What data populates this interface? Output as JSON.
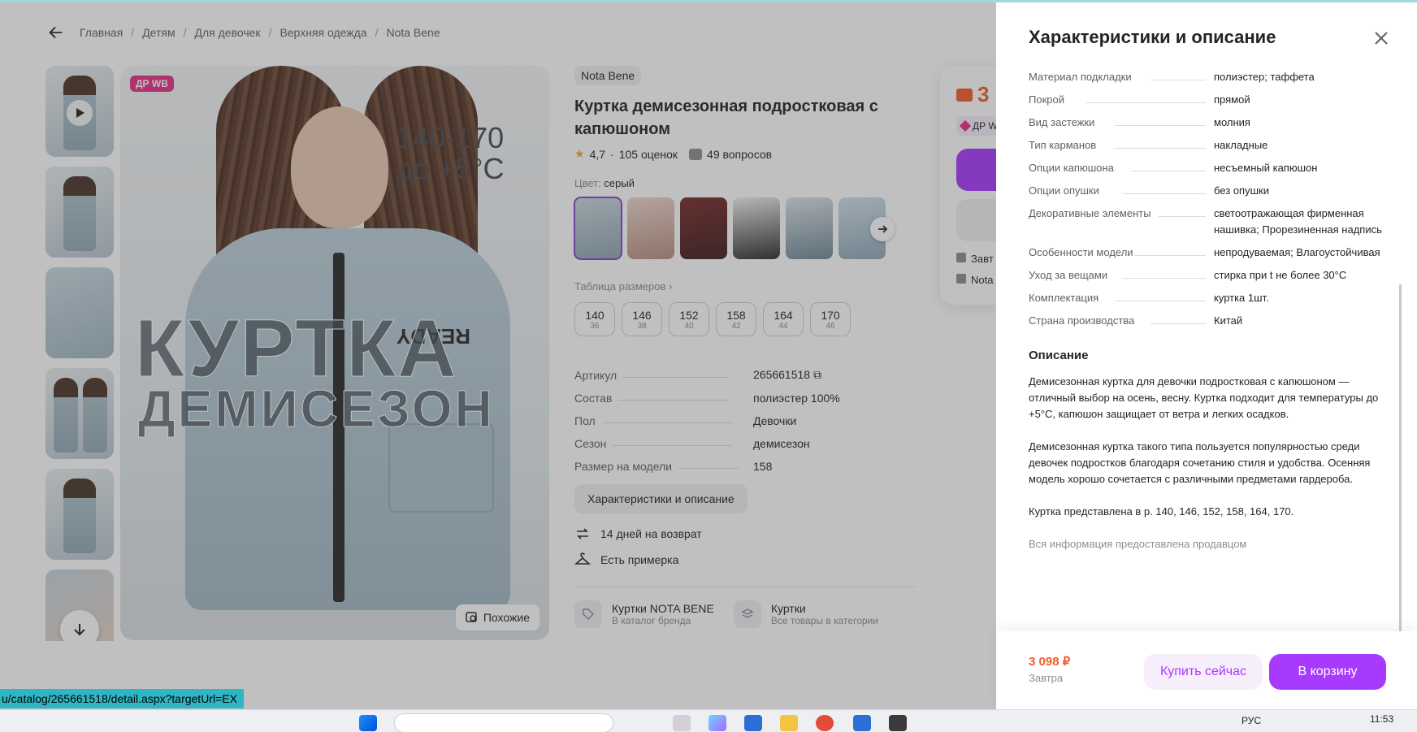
{
  "breadcrumbs": [
    "Главная",
    "Детям",
    "Для девочек",
    "Верхняя одежда",
    "Nota Bene"
  ],
  "product": {
    "badge": "ДР WB",
    "image_size_text": "140-170",
    "image_temp_text": "до +5°С",
    "image_title": "КУРТКА",
    "image_subtitle": "ДЕМИСЕЗОН",
    "image_print": "READY",
    "similar_label": "Похожие",
    "brand": "Nota Bene",
    "title": "Куртка демисезонная подростковая с капюшоном",
    "rating": "4,7",
    "reviews": "105 оценок",
    "questions": "49 вопросов",
    "color_label": "Цвет:",
    "color_value": "серый",
    "size_table_label": "Таблица размеров",
    "sizes": [
      {
        "a": "140",
        "b": "36"
      },
      {
        "a": "146",
        "b": "38"
      },
      {
        "a": "152",
        "b": "40"
      },
      {
        "a": "158",
        "b": "42"
      },
      {
        "a": "164",
        "b": "44"
      },
      {
        "a": "170",
        "b": "46"
      }
    ],
    "specs": [
      {
        "k": "Артикул",
        "v": "265661518"
      },
      {
        "k": "Состав",
        "v": "полиэстер 100%"
      },
      {
        "k": "Пол",
        "v": "Девочки"
      },
      {
        "k": "Сезон",
        "v": "демисезон"
      },
      {
        "k": "Размер на модели",
        "v": "158"
      }
    ],
    "char_button": "Характеристики и описание",
    "return_label": "14 дней на возврат",
    "fitting_label": "Есть примерка",
    "cats": [
      {
        "t1": "Куртки NOTA BENE",
        "t2": "В каталог бренда"
      },
      {
        "t1": "Куртки",
        "t2": "Все товары в категории"
      }
    ]
  },
  "buybox": {
    "price_partial": "3",
    "badge_partial": "ДР W",
    "delivery_partial": "Завт",
    "seller_partial": "Nota"
  },
  "status_url": "u/catalog/265661518/detail.aspx?targetUrl=EX",
  "panel": {
    "title": "Характеристики и описание",
    "rows": [
      {
        "k": "Материал подкладки",
        "v": "полиэстер; таффета"
      },
      {
        "k": "Покрой",
        "v": "прямой"
      },
      {
        "k": "Вид застежки",
        "v": "молния"
      },
      {
        "k": "Тип карманов",
        "v": "накладные"
      },
      {
        "k": "Опции капюшона",
        "v": "несъемный капюшон"
      },
      {
        "k": "Опции опушки",
        "v": "без опушки"
      },
      {
        "k": "Декоративные элементы",
        "v": "светоотражающая фирменная нашивка; Прорезиненная надпись"
      },
      {
        "k": "Особенности модели",
        "v": "непродуваемая; Влагоустойчивая"
      },
      {
        "k": "Уход за вещами",
        "v": "стирка при t не более 30°C"
      },
      {
        "k": "Комплектация",
        "v": "куртка 1шт."
      },
      {
        "k": "Страна производства",
        "v": "Китай"
      }
    ],
    "desc_title": "Описание",
    "desc_p1": "Демисезонная куртка для девочки подростковая с капюшоном — отличный выбор на осень, весну. Куртка подходит для температуры до +5°С, капюшон защищает от ветра и легких осадков.",
    "desc_p2": "Демисезонная куртка такого типа пользуется популярностью среди девочек подростков благодаря сочетанию стиля и удобства. Осенняя модель хорошо сочетается с различными предметами гардероба.",
    "desc_p3": "Куртка представлена в р. 140, 146, 152, 158, 164, 170.",
    "note": "Вся информация предоставлена продавцом",
    "price": "3 098 ₽",
    "date": "Завтра",
    "buy_now": "Купить сейчас",
    "to_cart": "В корзину"
  },
  "taskbar": {
    "lang": "РУС",
    "time": "11:53"
  },
  "colors": {
    "accent": "#a73afd",
    "price": "#f25c2a",
    "badge": "#e6308a"
  }
}
